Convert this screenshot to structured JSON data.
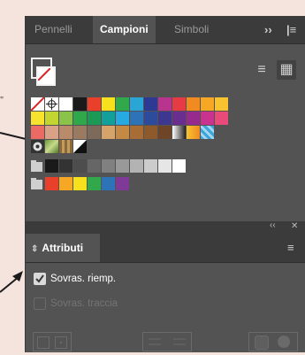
{
  "tabs": [
    {
      "label": "Pennelli",
      "active": false
    },
    {
      "label": "Campioni",
      "active": true
    },
    {
      "label": "Simboli",
      "active": false
    }
  ],
  "tab_icons": {
    "more": "››",
    "menu": "|≡"
  },
  "view_buttons": [
    {
      "icon": "list-view-icon",
      "glyph": "≡",
      "selected": false
    },
    {
      "icon": "grid-view-icon",
      "glyph": "▦",
      "selected": true
    }
  ],
  "colors": {
    "panel_bg": "#535353",
    "tabbar_bg": "#3b3b3b",
    "page_bg": "#f5e3de",
    "arrow": "#1a1a1a"
  },
  "swatch_rows": [
    [
      "none",
      "registration",
      "#ffffff",
      "#1a1a1a",
      "#e8402a",
      "#f6e11c",
      "#31a84a",
      "#2aa6d6",
      "#2d3a94",
      "#b8348e",
      "#e63a44",
      "#f08a21",
      "#f6a723",
      "#f7c430"
    ],
    [
      "#f7e22d",
      "#c3d531",
      "#8bc34a",
      "#2fa84b",
      "#1c9955",
      "#12a09b",
      "#27a9e1",
      "#2d73b8",
      "#2e4a9a",
      "#3d3790",
      "#6a2f8e",
      "#952b8c",
      "#c9338f",
      "#e84a7a"
    ],
    [
      "#ec6a64",
      "#d9a185",
      "#b98b6a",
      "#9b7a62",
      "#7e6a5a",
      "#d6a36b",
      "#c48944",
      "#a86d35",
      "#8e5a2c",
      "#6e4627",
      "gradient-white-black",
      "gradient-yellow",
      "pattern-blue"
    ],
    [
      "pattern-circle",
      "pattern-foliage",
      "pattern-brown",
      "new-swatch"
    ]
  ],
  "gray_group": [
    "#1a1a1a",
    "#333333",
    "#4d4d4d",
    "#666666",
    "#808080",
    "#999999",
    "#b3b3b3",
    "#cccccc",
    "#e6e6e6",
    "#ffffff"
  ],
  "bright_group": [
    "#e8402a",
    "#f6a723",
    "#f6e11c",
    "#31a84a",
    "#2d73b8",
    "#7e3a96"
  ],
  "attributes": {
    "header_icons": {
      "collapse": "‹‹",
      "close": "✕"
    },
    "tab_label": "Attributi",
    "tab_arrow": "⇕",
    "menu": "≡",
    "overprint_fill": {
      "label": "Sovras. riemp.",
      "checked": true
    },
    "overprint_stroke": {
      "label": "Sovras. traccia",
      "checked": false
    }
  }
}
